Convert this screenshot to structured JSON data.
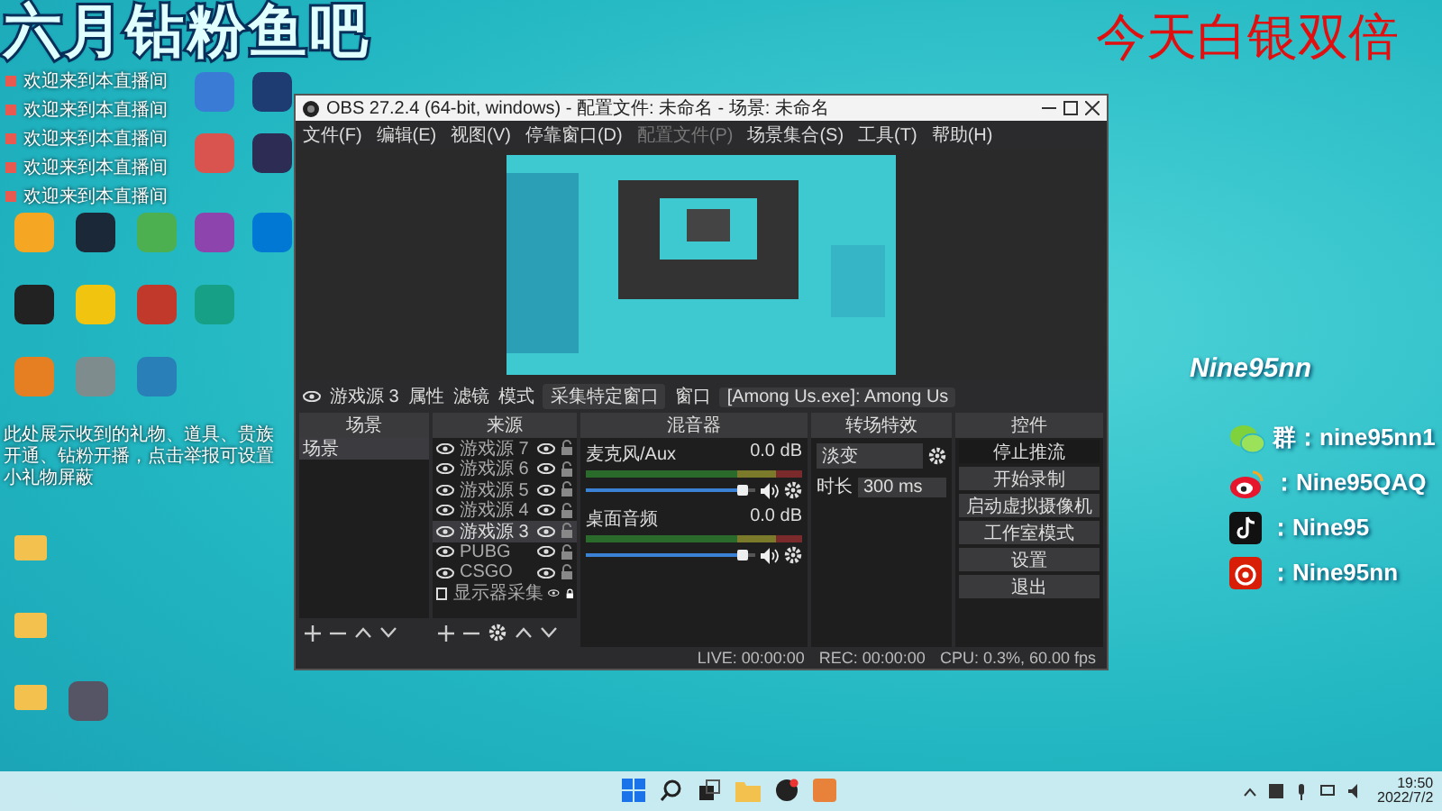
{
  "overlay": {
    "channel_title": "六月钻粉鱼吧",
    "promo": "今天白银双倍",
    "streamer": "Nine95nn",
    "socials": [
      {
        "kind": "wechat",
        "label": "群：nine95nn1"
      },
      {
        "kind": "weibo",
        "label": "：Nine95QAQ"
      },
      {
        "kind": "douyin",
        "label": "：Nine95"
      },
      {
        "kind": "netease",
        "label": "：Nine95nn"
      }
    ]
  },
  "desktop": {
    "notifications": [
      "欢迎来到本直播间",
      "欢迎来到本直播间",
      "欢迎来到本直播间",
      "欢迎来到本直播间",
      "欢迎来到本直播间"
    ],
    "notice": "此处展示收到的礼物、道具、贵族开通、钻粉开播，点击举报可设置小礼物屏蔽"
  },
  "obs": {
    "title": "OBS 27.2.4 (64-bit, windows) - 配置文件: 未命名 - 场景: 未命名",
    "menu": [
      {
        "label": "文件(F)",
        "disabled": false
      },
      {
        "label": "编辑(E)",
        "disabled": false
      },
      {
        "label": "视图(V)",
        "disabled": false
      },
      {
        "label": "停靠窗口(D)",
        "disabled": false
      },
      {
        "label": "配置文件(P)",
        "disabled": true
      },
      {
        "label": "场景集合(S)",
        "disabled": false
      },
      {
        "label": "工具(T)",
        "disabled": false
      },
      {
        "label": "帮助(H)",
        "disabled": false
      }
    ],
    "source_bar": {
      "source": "游戏源 3",
      "properties": "属性",
      "filters": "滤镜",
      "mode_label": "模式",
      "mode": "采集特定窗口",
      "window_label": "窗口",
      "window": "[Among Us.exe]: Among Us"
    },
    "scenes": {
      "title": "场景",
      "items": [
        {
          "label": "场景",
          "selected": true
        }
      ]
    },
    "sources": {
      "title": "来源",
      "items": [
        {
          "kind": "game",
          "label": "游戏源 7",
          "selected": false,
          "locked": false
        },
        {
          "kind": "game",
          "label": "游戏源 6",
          "selected": false,
          "locked": false
        },
        {
          "kind": "game",
          "label": "游戏源 5",
          "selected": false,
          "locked": false
        },
        {
          "kind": "game",
          "label": "游戏源 4",
          "selected": false,
          "locked": false
        },
        {
          "kind": "game",
          "label": "游戏源 3",
          "selected": true,
          "locked": false
        },
        {
          "kind": "game",
          "label": "PUBG",
          "selected": false,
          "locked": false
        },
        {
          "kind": "game",
          "label": "CSGO",
          "selected": false,
          "locked": false
        },
        {
          "kind": "display",
          "label": "显示器采集",
          "selected": false,
          "locked": true
        }
      ]
    },
    "mixer": {
      "title": "混音器",
      "channels": [
        {
          "name": "麦克风/Aux",
          "reading": "0.0 dB",
          "level": 0.93
        },
        {
          "name": "桌面音频",
          "reading": "0.0 dB",
          "level": 0.93
        }
      ]
    },
    "transitions": {
      "title": "转场特效",
      "effect": "淡变",
      "duration_label": "时长",
      "duration": "300 ms"
    },
    "controls": {
      "title": "控件",
      "buttons": [
        {
          "label": "停止推流",
          "selected": true
        },
        {
          "label": "开始录制",
          "selected": false
        },
        {
          "label": "启动虚拟摄像机",
          "selected": false
        },
        {
          "label": "工作室模式",
          "selected": false
        },
        {
          "label": "设置",
          "selected": false
        },
        {
          "label": "退出",
          "selected": false
        }
      ]
    },
    "status": {
      "live": "LIVE: 00:00:00",
      "rec": "REC: 00:00:00",
      "cpu": "CPU: 0.3%, 60.00 fps"
    }
  },
  "taskbar": {
    "time": "19:50",
    "date": "2022/7/2"
  }
}
